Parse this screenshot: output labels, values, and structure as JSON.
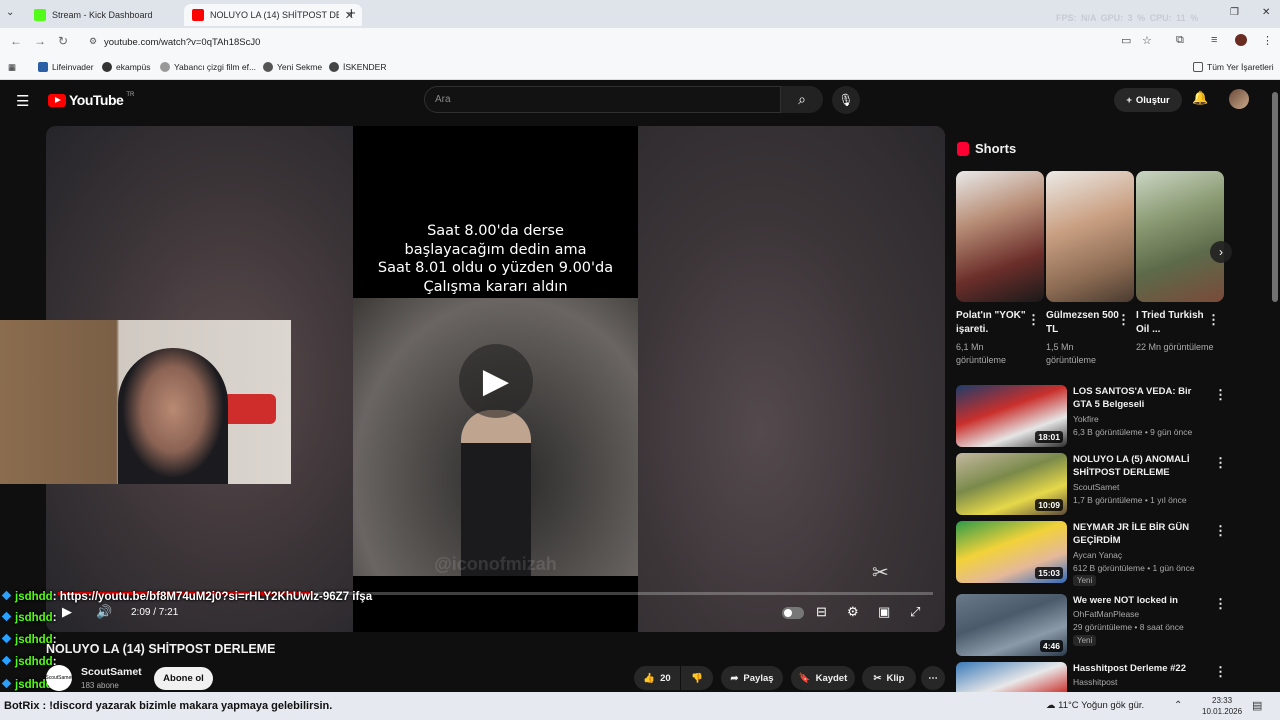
{
  "browser": {
    "tabs": [
      {
        "title": "Stream - Kick Dashboard",
        "active": false,
        "favicon_color": "#53fc18"
      },
      {
        "title": "NOLUYO LA (14) SHİTPOST DE",
        "active": true,
        "favicon_color": "#ff0000"
      }
    ],
    "perf": "FPS: N/A   GPU: 3 %   CPU: 11 %",
    "url": "youtube.com/watch?v=0qTAh18ScJ0",
    "bookmarks": [
      "Lifeinvader",
      "ekampüs",
      "Yabancı çizgi film ef...",
      "Yeni Sekme",
      "İSKENDER"
    ],
    "bookmarks_right": "Tüm Yer İşaretleri"
  },
  "youtube": {
    "logo_text": "YouTube",
    "region": "TR",
    "search_placeholder": "Ara",
    "create_label": "Oluştur"
  },
  "player": {
    "caption_lines": [
      "Saat 8.00'da derse",
      "başlayacağım dedin ama",
      "Saat 8.01 oldu o yüzden 9.00'da",
      "Çalışma kararı aldın"
    ],
    "watermark": "@iconofmizah",
    "time": "2:09 / 7:21",
    "progress": 0.2925,
    "hd_badge": "HD"
  },
  "chat": [
    {
      "user": "jsdhdd",
      "text": ": https://youtu.be/bf8M74uM2j0?si=rHLY2KhUwlz-96Z7 ifşa"
    },
    {
      "user": "jsdhdd",
      "text": ":"
    },
    {
      "user": "jsdhdd",
      "text": ":"
    },
    {
      "user": "jsdhdd",
      "text": ":"
    },
    {
      "user": "jsdhdd",
      "text": ":"
    }
  ],
  "video": {
    "title": "NOLUYO LA (14) SHİTPOST DERLEME",
    "channel": "ScoutSamet",
    "subscribers": "183 abone",
    "subscribe_label": "Abone ol",
    "likes": "20",
    "share_label": "Paylaş",
    "save_label": "Kaydet",
    "clip_label": "Klip"
  },
  "shorts": {
    "heading": "Shorts",
    "items": [
      {
        "title": "Polat'ın \"YOK\" işareti.",
        "views": "6,1 Mn görüntüleme",
        "color": "#6b2e2a"
      },
      {
        "title": "Gülmezsen 500 TL",
        "views": "1,5 Mn görüntüleme",
        "color": "#8a6a52"
      },
      {
        "title": "I Tried Turkish Oil ...",
        "views": "22 Mn görüntüleme",
        "color": "#5d6a4a"
      }
    ]
  },
  "recommendations": [
    {
      "title": "LOS SANTOS'A VEDA: Bir GTA 5 Belgeseli",
      "channel": "Yokfire",
      "meta": "6,3 B görüntüleme • 9 gün önce",
      "duration": "18:01",
      "new": "",
      "color": "#3b5f8a"
    },
    {
      "title": "NOLUYO LA (5) ANOMALİ SHİTPOST DERLEME",
      "channel": "ScoutSamet",
      "meta": "1,7 B görüntüleme • 1 yıl önce",
      "duration": "10:09",
      "new": "",
      "color": "#7a8a4a"
    },
    {
      "title": "NEYMAR JR İLE BİR GÜN GEÇİRDİM",
      "channel": "Aycan Yanaç",
      "meta": "612 B görüntüleme • 1 gün önce",
      "duration": "15:03",
      "new": "Yeni",
      "color": "#2e9a4a"
    },
    {
      "title": "We were NOT locked in",
      "channel": "OhFatManPlease",
      "meta": "29 görüntüleme • 8 saat önce",
      "duration": "4:46",
      "new": "Yeni",
      "color": "#4a5a6a"
    },
    {
      "title": "Hasshitpost Derleme #22",
      "channel": "Hasshitpost",
      "meta": "",
      "duration": "",
      "new": "",
      "color": "#3a7ab8"
    }
  ],
  "taskbar": {
    "ticker": "BotRix : !discord yazarak bizimle makara yapmaya gelebilirsin.",
    "weather": "11°C  Yoğun gök gür.",
    "time": "23:33",
    "date": "10.01.2026"
  }
}
